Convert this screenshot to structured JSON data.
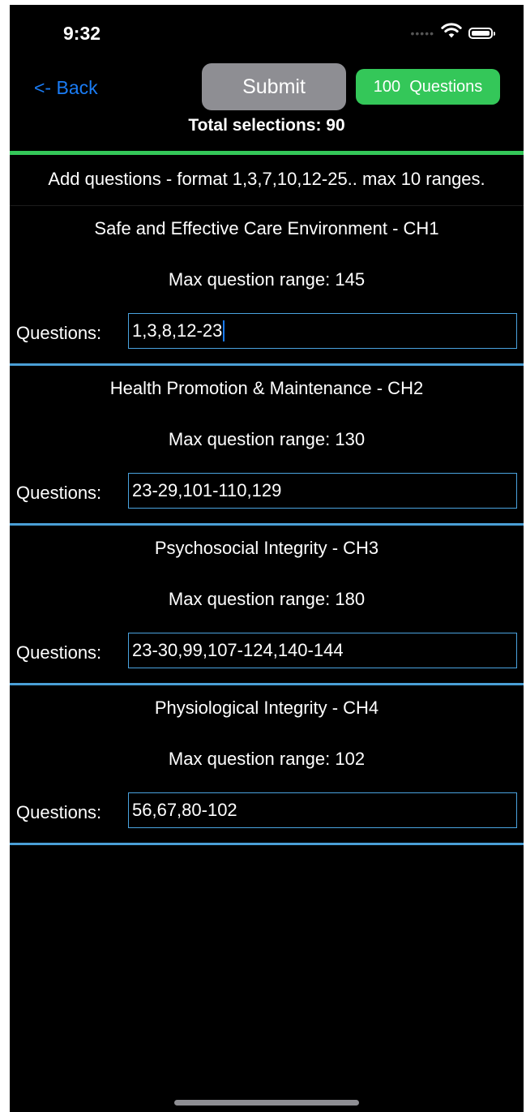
{
  "status_bar": {
    "time": "9:32",
    "signal_icon": "signal-dots-icon",
    "wifi_icon": "wifi-icon",
    "battery_icon": "battery-icon",
    "battery_level": 1.0
  },
  "header": {
    "back_label": "<- Back",
    "submit_label": "Submit",
    "questions_badge": "100  Questions",
    "total_selections": "Total selections: 90"
  },
  "format_hint": "Add questions - format 1,3,7,10,12-25.. max 10 ranges.",
  "questions_field_label": "Questions:",
  "sections": [
    {
      "title": "Safe and Effective Care Environment - CH1",
      "max_range": "Max question range: 145",
      "value": "1,3,8,12-23",
      "focused": true
    },
    {
      "title": "Health Promotion & Maintenance - CH2",
      "max_range": "Max question range: 130",
      "value": "23-29,101-110,129",
      "focused": false
    },
    {
      "title": "Psychosocial Integrity - CH3",
      "max_range": "Max question range: 180",
      "value": "23-30,99,107-124,140-144",
      "focused": false
    },
    {
      "title": "Physiological Integrity - CH4",
      "max_range": "Max question range: 102",
      "value": "56,67,80-102",
      "focused": false
    }
  ],
  "colors": {
    "background": "#000000",
    "link": "#1a7cf5",
    "submit_button": "#8e8e93",
    "badge": "#34c759",
    "divider_green": "#34c759",
    "divider_blue": "#4a9fd6",
    "input_border": "#4aa3df"
  }
}
